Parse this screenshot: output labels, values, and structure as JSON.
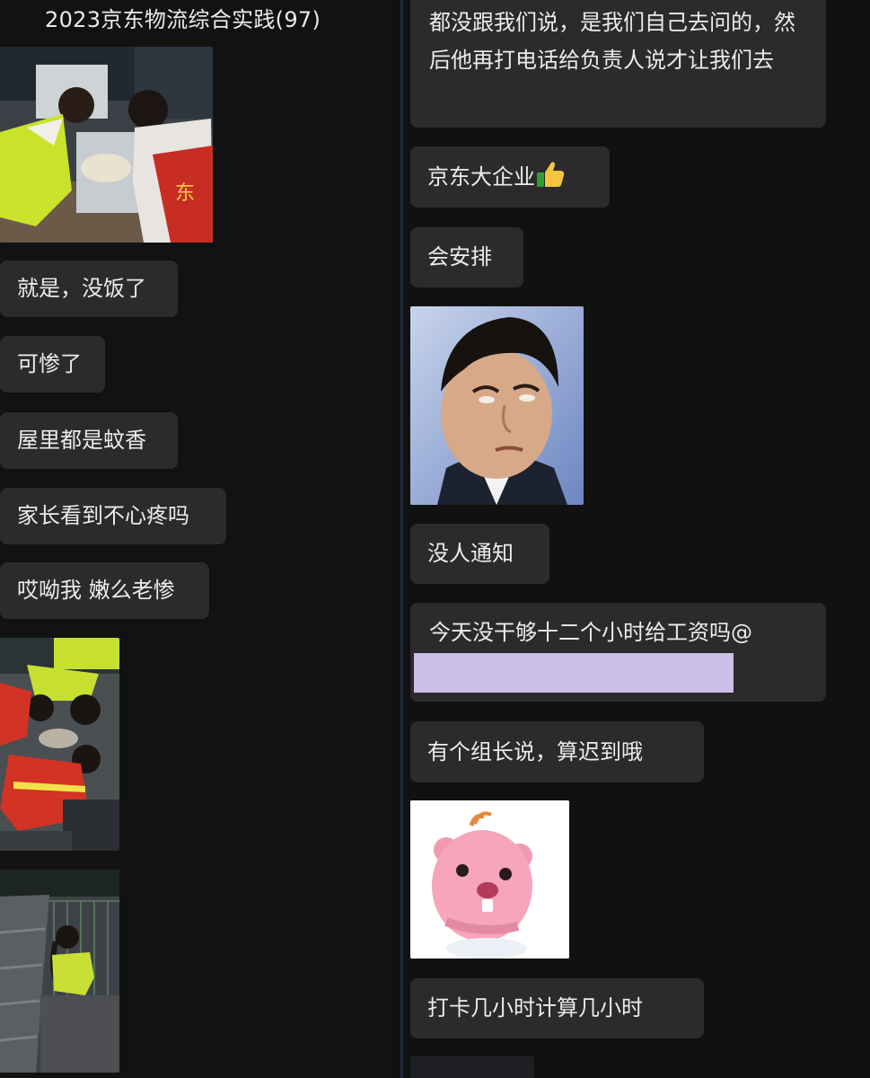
{
  "left": {
    "chat_title": "2023京东物流综合实践(97)",
    "messages": [
      "就是，没饭了",
      "可惨了",
      "屋里都是蚊香",
      "家长看到不心疼吗",
      "哎呦我 嫩么老惨"
    ]
  },
  "right": {
    "msg1": "都没跟我们说，是我们自己去问的，然后他再打电话给负责人说才让我们去",
    "msg2": "京东大企业",
    "msg3": "会安排",
    "msg4": "没人通知",
    "msg5": "今天没干够十二个小时给工资吗@",
    "msg6": "有个组长说，算迟到哦",
    "msg7": "打卡几小时计算几小时"
  },
  "icons": {
    "thumbs_up": "thumbs-up-emoji"
  },
  "colors": {
    "bubble": "#2b2b2b",
    "background": "#121212",
    "mention_highlight": "#cbbfe8"
  }
}
